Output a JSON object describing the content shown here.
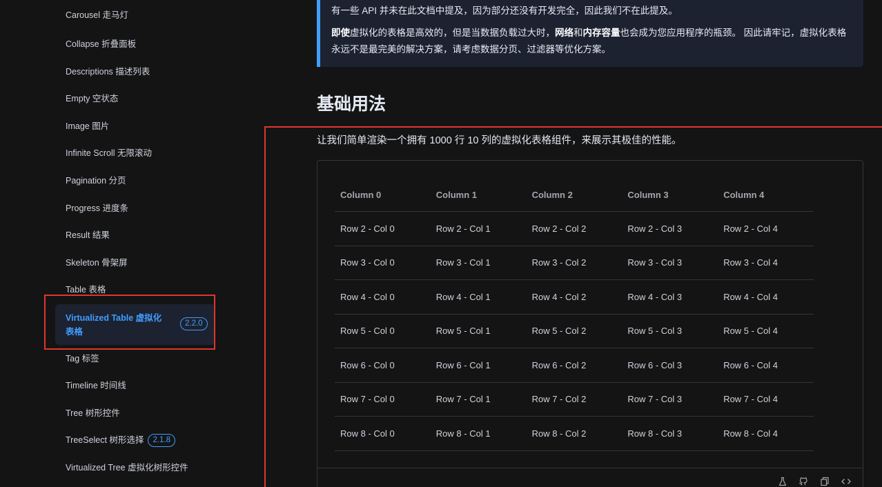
{
  "sidebar": {
    "items": [
      {
        "label": "Carousel 走马灯"
      },
      {
        "label": "Collapse 折叠面板"
      },
      {
        "label": "Descriptions 描述列表"
      },
      {
        "label": "Empty 空状态"
      },
      {
        "label": "Image 图片"
      },
      {
        "label": "Infinite Scroll 无限滚动"
      },
      {
        "label": "Pagination 分页"
      },
      {
        "label": "Progress 进度条"
      },
      {
        "label": "Result 结果"
      },
      {
        "label": "Skeleton 骨架屏"
      },
      {
        "label": "Table 表格"
      }
    ],
    "active": {
      "label": "Virtualized Table 虚拟化表格",
      "badge": "2.2.0"
    },
    "items_after": [
      {
        "label": "Tag 标签"
      },
      {
        "label": "Timeline 时间线"
      },
      {
        "label": "Tree 树形控件"
      },
      {
        "label": "TreeSelect 树形选择",
        "badge": "2.1.8"
      },
      {
        "label": "Virtualized Tree 虚拟化树形控件"
      }
    ]
  },
  "tip": {
    "line1": "有一些 API 并未在此文档中提及，因为部分还没有开发完全，因此我们不在此提及。",
    "p2_b1": "即使",
    "p2_t1": "虚拟化的表格是高效的，但是当数据负载过大时，",
    "p2_b2": "网络",
    "p2_t2": "和",
    "p2_b3": "内存容量",
    "p2_t3": "也会成为您应用程序的瓶颈。 因此请牢记，虚拟化表格永远不是最完美的解决方案，请考虑数据分页、过滤器等优化方案。"
  },
  "section": {
    "title": "基础用法",
    "description": "让我们简单渲染一个拥有 1000 行 10 列的虚拟化表格组件，来展示其极佳的性能。"
  },
  "table": {
    "columns": [
      "Column 0",
      "Column 1",
      "Column 2",
      "Column 3",
      "Column 4"
    ],
    "rows": [
      [
        "Row 2 - Col 0",
        "Row 2 - Col 1",
        "Row 2 - Col 2",
        "Row 2 - Col 3",
        "Row 2 - Col 4"
      ],
      [
        "Row 3 - Col 0",
        "Row 3 - Col 1",
        "Row 3 - Col 2",
        "Row 3 - Col 3",
        "Row 3 - Col 4"
      ],
      [
        "Row 4 - Col 0",
        "Row 4 - Col 1",
        "Row 4 - Col 2",
        "Row 4 - Col 3",
        "Row 4 - Col 4"
      ],
      [
        "Row 5 - Col 0",
        "Row 5 - Col 1",
        "Row 5 - Col 2",
        "Row 5 - Col 3",
        "Row 5 - Col 4"
      ],
      [
        "Row 6 - Col 0",
        "Row 6 - Col 1",
        "Row 6 - Col 2",
        "Row 6 - Col 3",
        "Row 6 - Col 4"
      ],
      [
        "Row 7 - Col 0",
        "Row 7 - Col 1",
        "Row 7 - Col 2",
        "Row 7 - Col 3",
        "Row 7 - Col 4"
      ],
      [
        "Row 8 - Col 0",
        "Row 8 - Col 1",
        "Row 8 - Col 2",
        "Row 8 - Col 3",
        "Row 8 - Col 4"
      ]
    ]
  },
  "demo_controls": {
    "icons": [
      "playground-icon",
      "github-icon",
      "copy-icon",
      "code-icon"
    ]
  },
  "colors": {
    "accent": "#409eff",
    "highlight": "#e0362c",
    "background": "#141414"
  }
}
